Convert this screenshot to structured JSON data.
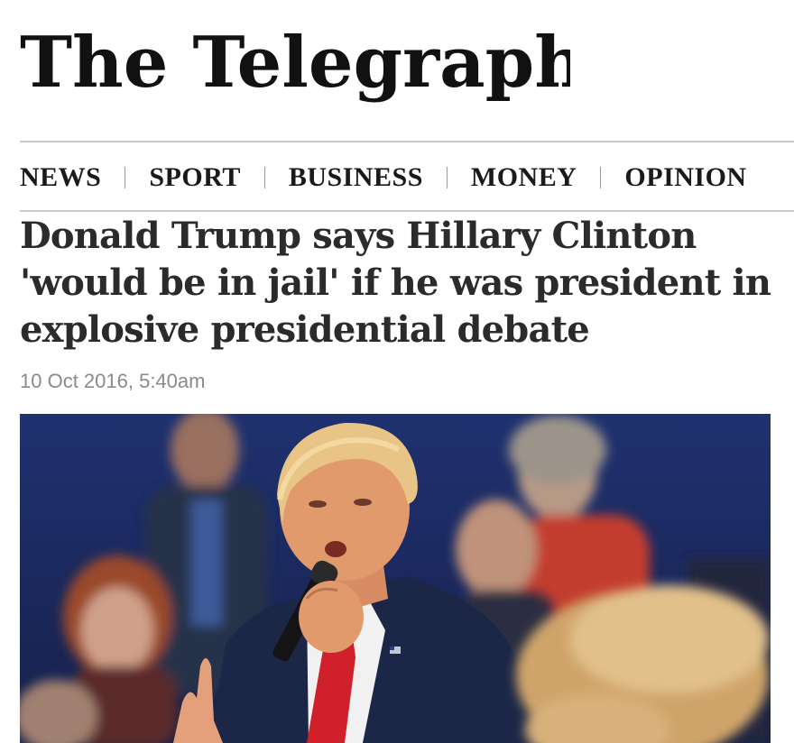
{
  "masthead": {
    "title": "The Telegraph"
  },
  "nav": {
    "items": [
      {
        "label": "NEWS"
      },
      {
        "label": "SPORT"
      },
      {
        "label": "BUSINESS"
      },
      {
        "label": "MONEY"
      },
      {
        "label": "OPINION"
      }
    ]
  },
  "article": {
    "headline": "Donald Trump says Hillary Clinton 'would be in jail' if he was president in explosive presidential debate",
    "date": "10 Oct 2016, 5:40am"
  },
  "colors": {
    "text": "#2b2b2b",
    "date": "#8a8a8a",
    "rule": "#c9c9c9",
    "photo_background": "#1b2a5a"
  }
}
